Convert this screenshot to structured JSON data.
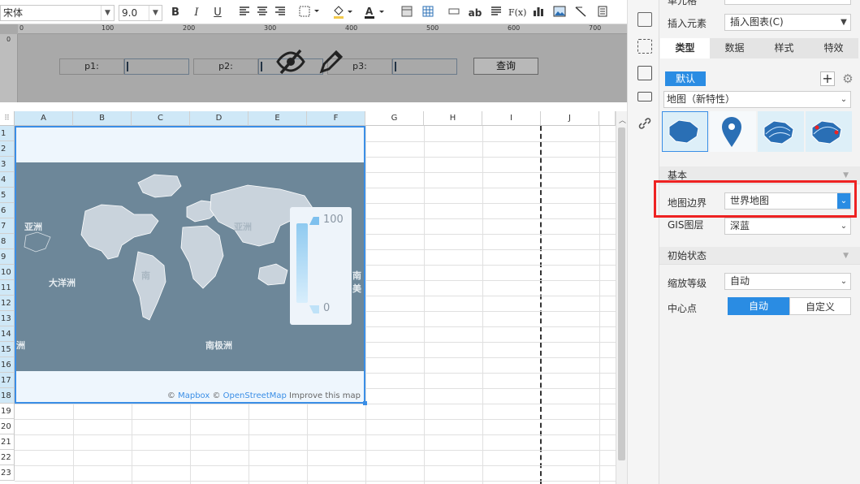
{
  "toolbar": {
    "font_family": "宋体",
    "font_size": "9.0",
    "bold_label": "B",
    "italic_label": "I",
    "underline_label": "U",
    "ab_label": "ab",
    "fx_label": "F(x)",
    "fill_color": "#f2c94c",
    "text_color": "#e23b3b"
  },
  "ruler": {
    "ticks": [
      "0",
      "100",
      "200",
      "300",
      "400",
      "500",
      "600",
      "700"
    ],
    "vertical_tick": "0"
  },
  "param_pane": {
    "p1_label": "p1:",
    "p2_label": "p2:",
    "p3_label": "p3:",
    "query_button": "查询"
  },
  "sheet": {
    "columns": [
      "A",
      "B",
      "C",
      "D",
      "E",
      "F",
      "G",
      "H",
      "I",
      "J"
    ],
    "rows": [
      "1",
      "2",
      "3",
      "4",
      "5",
      "6",
      "7",
      "8",
      "9",
      "10",
      "11",
      "12",
      "13",
      "14",
      "15",
      "16",
      "17",
      "18",
      "19",
      "20",
      "21",
      "22",
      "23"
    ]
  },
  "map": {
    "labels": {
      "asia": "亚洲",
      "oceania": "大洋洲",
      "antarctica": "南极洲",
      "americas_partial": "南美",
      "africa_partial": "洲",
      "asia_right": "亚洲",
      "n_partial": "南"
    },
    "legend_max": "100",
    "legend_min": "0",
    "credit_prefix": "©",
    "credit_mapbox": "Mapbox",
    "credit_mid": "©",
    "credit_osm": "OpenStreetMap",
    "credit_improve": "Improve this map"
  },
  "panel": {
    "top_label": "单元格",
    "insert_label": "插入元素",
    "insert_value": "插入图表(C)",
    "tabs": [
      "类型",
      "数据",
      "样式",
      "特效"
    ],
    "active_tab": "类型",
    "default_button": "默认",
    "chart_type": "地图（新特性）",
    "section_basic": "基本",
    "map_boundary_label": "地图边界",
    "map_boundary_value": "世界地图",
    "gis_label": "GIS图层",
    "gis_value": "深蓝",
    "section_initial": "初始状态",
    "zoom_label": "缩放等级",
    "zoom_value": "自动",
    "center_label": "中心点",
    "center_auto": "自动",
    "center_custom": "自定义"
  }
}
